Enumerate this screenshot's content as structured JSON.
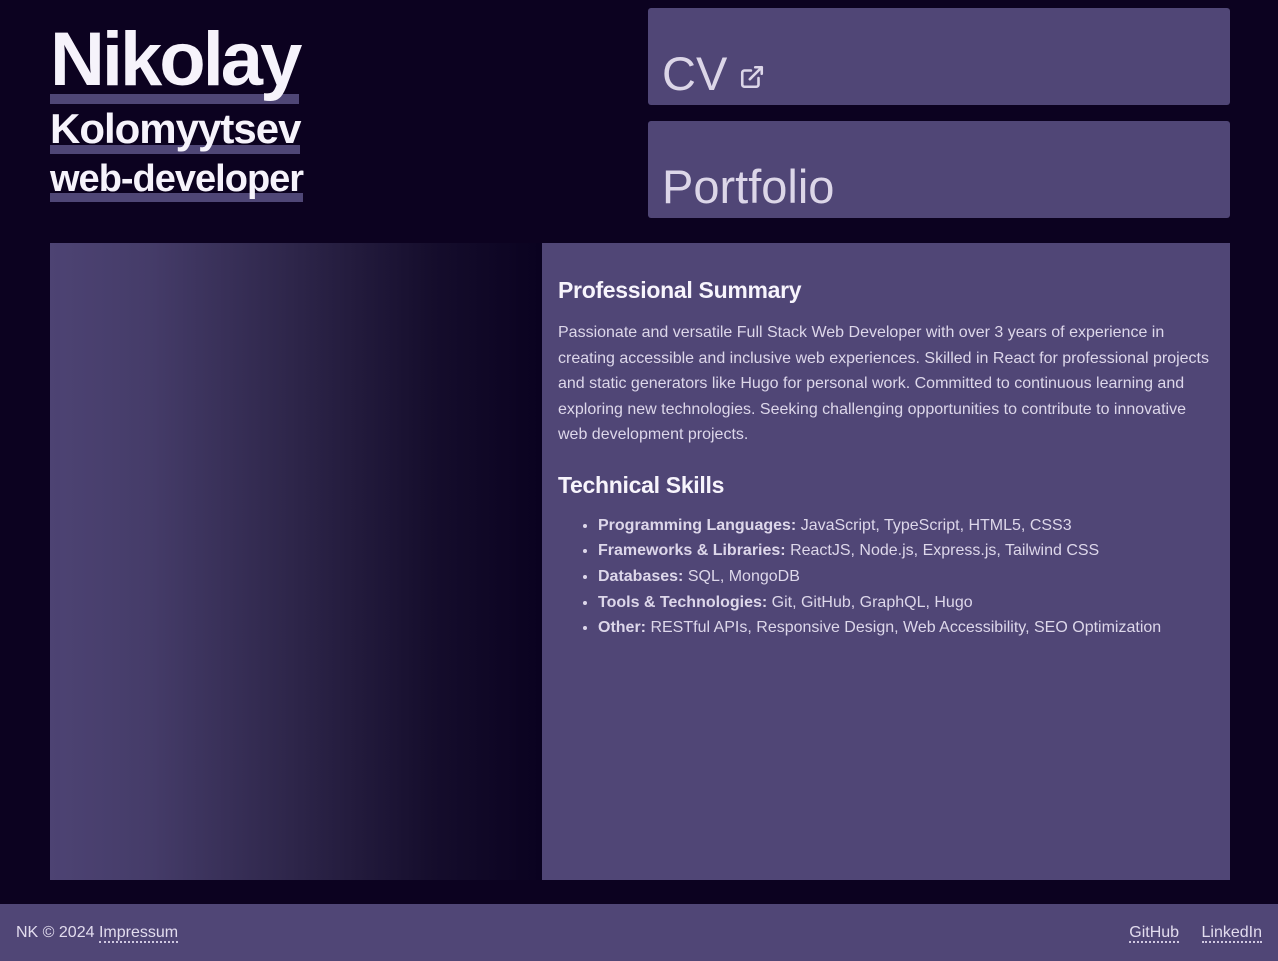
{
  "header": {
    "first_name": "Nikolay",
    "last_name": "Kolomyytsev",
    "role": "web-developer"
  },
  "links": {
    "cv_label": "CV",
    "cv_icon": "external-link-icon",
    "portfolio_label": "Portfolio"
  },
  "summary": {
    "title": "Professional Summary",
    "text": "Passionate and versatile Full Stack Web Developer with over 3 years of experience in creating accessible and inclusive web experiences. Skilled in React for professional projects and static generators like Hugo for personal work. Committed to continuous learning and exploring new technologies. Seeking challenging opportunities to contribute to innovative web development projects."
  },
  "skills": {
    "title": "Technical Skills",
    "items": [
      {
        "category": "Programming Languages:",
        "value": " JavaScript, TypeScript, HTML5, CSS3"
      },
      {
        "category": "Frameworks & Libraries:",
        "value": " ReactJS, Node.js, Express.js, Tailwind CSS"
      },
      {
        "category": "Databases:",
        "value": " SQL, MongoDB"
      },
      {
        "category": "Tools & Technologies:",
        "value": " Git, GitHub, GraphQL, Hugo"
      },
      {
        "category": "Other:",
        "value": " RESTful APIs, Responsive Design, Web Accessibility, SEO Optimization"
      }
    ]
  },
  "footer": {
    "copyright": "NK © 2024",
    "impressum": "Impressum",
    "github": "GitHub",
    "linkedin": "LinkedIn"
  },
  "colors": {
    "background": "#0c0220",
    "panel": "#504676",
    "highlight": "#4f4676",
    "text": "#ddd7ea",
    "heading": "#f7f4fc"
  }
}
